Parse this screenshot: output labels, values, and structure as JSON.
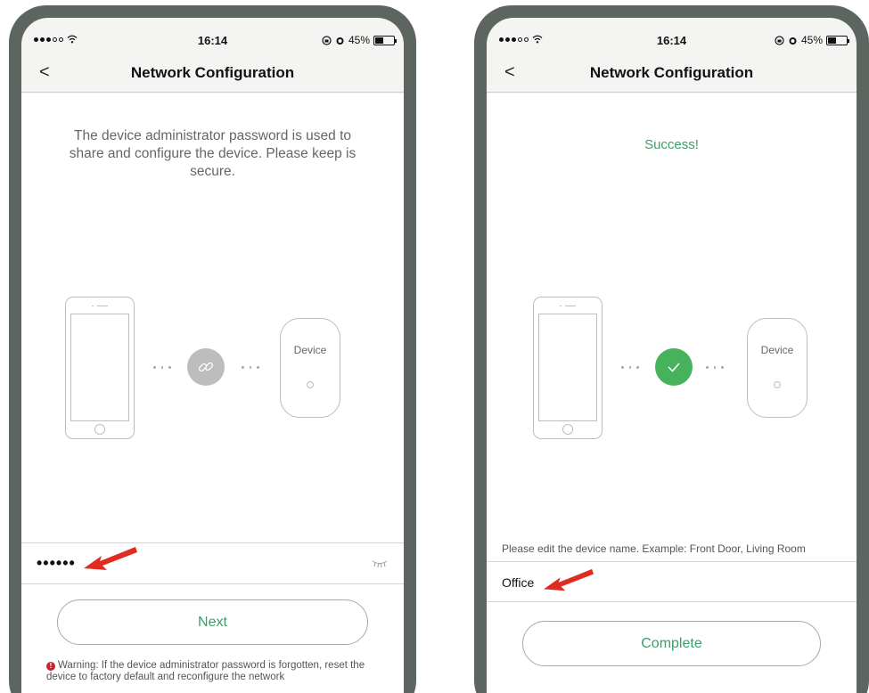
{
  "status_bar": {
    "time": "16:14",
    "battery": "45%",
    "battery_level": 0.45
  },
  "nav": {
    "title": "Network Configuration",
    "back_glyph": "<"
  },
  "left_screen": {
    "description": "The device administrator password is used to share and configure the device. Please keep is secure.",
    "device_label": "Device",
    "center_icon": "link-icon",
    "password_value": "••••••",
    "show_password_icon": "eye-closed-icon",
    "next_button": "Next",
    "warning_text": "Warning: If the device administrator password is forgotten, reset the device to factory default and reconfigure the network"
  },
  "right_screen": {
    "status": "Success!",
    "device_label": "Device",
    "center_icon": "checkmark-icon",
    "name_hint": "Please edit the device name. Example: Front Door, Living Room",
    "device_name_value": "Office",
    "complete_button": "Complete"
  },
  "colors": {
    "accent_green": "#3e9b6c",
    "success_circle": "#47b25c",
    "link_circle": "#bdbdbd",
    "annotation_arrow": "#e02b20",
    "phone_frame": "#5d6560",
    "warning_red": "#c4262e"
  }
}
